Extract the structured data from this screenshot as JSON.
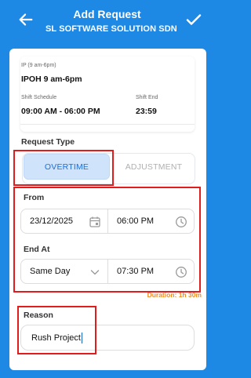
{
  "header": {
    "title": "Add Request",
    "subtitle": "SL SOFTWARE SOLUTION SDN ...",
    "back_icon": "arrow-left-icon",
    "confirm_icon": "check-icon"
  },
  "shift": {
    "name_label": "IP (9 am-6pm)",
    "name_value": "IPOH 9 am-6pm",
    "schedule_label": "Shift Schedule",
    "schedule_value": "09:00 AM - 06:00 PM",
    "end_label": "Shift End",
    "end_value": "23:59"
  },
  "request_type": {
    "label": "Request Type",
    "options": [
      "OVERTIME",
      "ADJUSTMENT"
    ],
    "selected": "OVERTIME"
  },
  "from": {
    "label": "From",
    "date": "23/12/2025",
    "time": "06:00 PM"
  },
  "end_at": {
    "label": "End At",
    "day": "Same Day",
    "time": "07:30 PM"
  },
  "duration": "Duration: 1h 30m",
  "reason": {
    "label": "Reason",
    "value": "Rush Project"
  },
  "colors": {
    "primary": "#1e88e5",
    "selected_bg": "#cfe3fb",
    "selected_text": "#1e6fd9",
    "duration": "#f28a1e",
    "highlight": "#e01c1c"
  }
}
